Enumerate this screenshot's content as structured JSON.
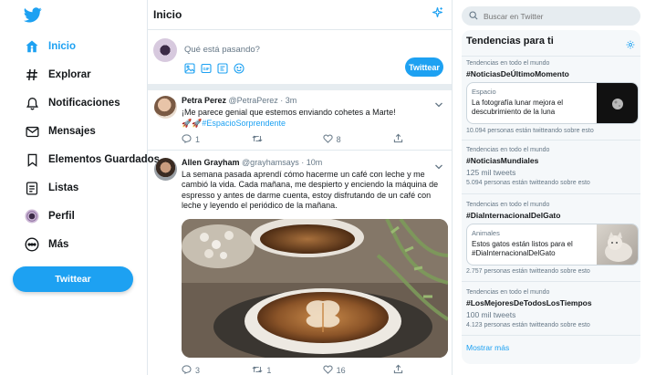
{
  "nav": {
    "items": [
      {
        "label": "Inicio",
        "icon": "home-icon",
        "active": true
      },
      {
        "label": "Explorar",
        "icon": "hashtag-icon"
      },
      {
        "label": "Notificaciones",
        "icon": "bell-icon"
      },
      {
        "label": "Mensajes",
        "icon": "mail-icon"
      },
      {
        "label": "Elementos Guardados",
        "icon": "bookmark-icon"
      },
      {
        "label": "Listas",
        "icon": "list-icon"
      },
      {
        "label": "Perfil",
        "icon": "avatar-icon"
      },
      {
        "label": "Más",
        "icon": "more-icon"
      }
    ],
    "tweet_button": "Twittear"
  },
  "main": {
    "title": "Inicio",
    "composer": {
      "placeholder": "Qué está pasando?",
      "button": "Twittear"
    },
    "tweets": [
      {
        "name": "Petra Perez",
        "handle": "@PetraPerez",
        "time": "3m",
        "text": "¡Me parece genial que estemos enviando cohetes a Marte!",
        "emoji": "🚀🚀",
        "hashtag": "#EspacioSorprendente",
        "replies": "1",
        "retweets": "",
        "likes": "8"
      },
      {
        "name": "Allen Grayham",
        "handle": "@grayhamsays",
        "time": "10m",
        "text": "La semana pasada aprendí cómo hacerme un café con leche y me cambió la vida. Cada mañana, me despierto y enciendo la máquina de espresso y antes de darme cuenta, estoy disfrutando de un café con leche y leyendo el periódico de la mañana.",
        "replies": "3",
        "retweets": "1",
        "likes": "16"
      }
    ]
  },
  "right": {
    "search_placeholder": "Buscar en Twitter",
    "trends_title": "Tendencias para ti",
    "trends": [
      {
        "context": "Tendencias en todo el mundo",
        "tag": "#NoticiasDeÚltimoMomento",
        "card": {
          "category": "Espacio",
          "text": "La fotografía lunar mejora el descubrimiento de la luna"
        },
        "count": "10.094 personas están twitteando sobre esto"
      },
      {
        "context": "Tendencias en todo el mundo",
        "tag": "#NoticiasMundiales",
        "tweets": "125 mil tweets",
        "count": "5.094 personas están twitteando sobre esto"
      },
      {
        "context": "Tendencias en todo el mundo",
        "tag": "#DiaInternacionalDelGato",
        "card": {
          "category": "Animales",
          "text": "Estos gatos están listos para el #DiaInternacionalDelGato"
        },
        "count": "2.757 personas están twitteando sobre esto"
      },
      {
        "context": "Tendencias en todo el mundo",
        "tag": "#LosMejoresDeTodosLosTiempos",
        "tweets": "100 mil tweets",
        "count": "4.123 personas están twitteando sobre esto"
      }
    ],
    "show_more": "Mostrar más"
  },
  "colors": {
    "accent": "#1da1f2",
    "text": "#14171a",
    "muted": "#657786",
    "border": "#e1e8ed"
  }
}
